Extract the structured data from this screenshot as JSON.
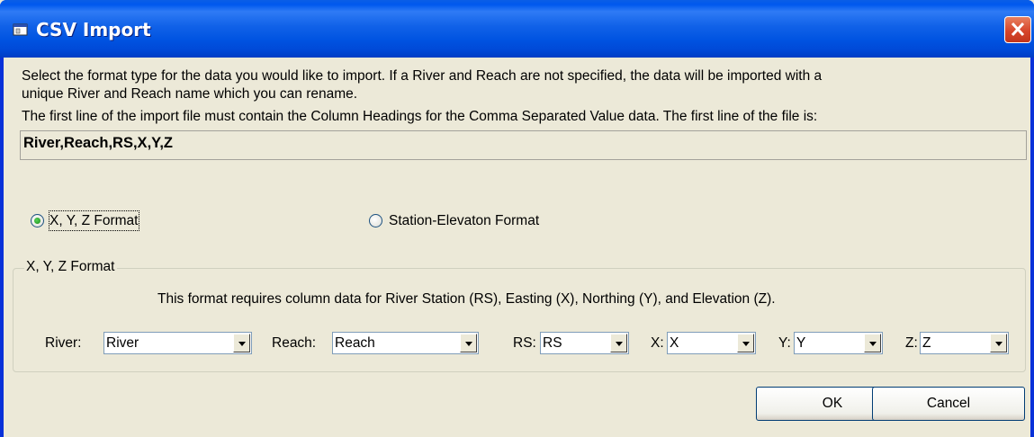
{
  "window": {
    "title": "CSV Import",
    "icon": "window-app-icon",
    "close_icon": "close-icon"
  },
  "instructions": {
    "line1": "Select the format type for the data you would like to import.  If a River and Reach are not specified, the data will be imported with a",
    "line2": "unique River and Reach name which you can rename.",
    "line3": "The first line of the import file must contain the Column Headings for the Comma Separated Value data. The first line of the file is:"
  },
  "first_line_value": "River,Reach,RS,X,Y,Z",
  "format_options": {
    "xyz_label": "X, Y, Z Format",
    "xyz_selected": true,
    "station_label": "Station-Elevaton Format",
    "station_selected": false
  },
  "group": {
    "label": "X, Y, Z Format",
    "description": "This format requires column data for River Station (RS), Easting (X), Northing (Y), and Elevation (Z).",
    "river_label": "River:",
    "river_value": "River",
    "reach_label": "Reach:",
    "reach_value": "Reach",
    "rs_label": "RS:",
    "rs_value": "RS",
    "x_label": "X:",
    "x_value": "X",
    "y_label": "Y:",
    "y_value": "Y",
    "z_label": "Z:",
    "z_value": "Z"
  },
  "buttons": {
    "ok": "OK",
    "cancel": "Cancel"
  },
  "colors": {
    "titlebar": "#0054e3",
    "dialog_face": "#ece9d8",
    "close_button": "#d7462b"
  }
}
